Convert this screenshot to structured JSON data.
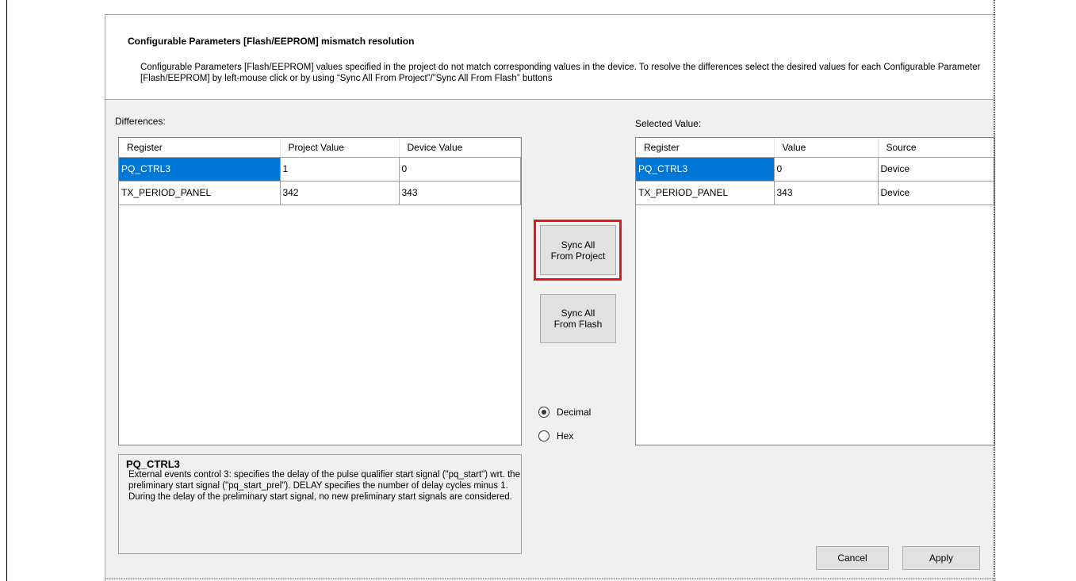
{
  "dialog": {
    "title": "Configurable Parameters [Flash/EEPROM] mismatch resolution",
    "description": "Configurable Parameters [Flash/EEPROM] values specified in the project do not match corresponding values in the device. To resolve the differences select the desired values for each Configurable Parameter [Flash/EEPROM] by left-mouse click or by using “Sync All From Project”/”Sync All From Flash” buttons"
  },
  "differences": {
    "label": "Differences:",
    "columns": [
      "Register",
      "Project Value",
      "Device Value"
    ],
    "rows": [
      [
        "PQ_CTRL3",
        "1",
        "0"
      ],
      [
        "TX_PERIOD_PANEL",
        "342",
        "343"
      ]
    ]
  },
  "selected": {
    "label": "Selected Value:",
    "columns": [
      "Register",
      "Value",
      "Source"
    ],
    "rows": [
      [
        "PQ_CTRL3",
        "0",
        "Device"
      ],
      [
        "TX_PERIOD_PANEL",
        "343",
        "Device"
      ]
    ]
  },
  "buttons": {
    "sync_project_line1": "Sync All",
    "sync_project_line2": "From Project",
    "sync_flash_line1": "Sync All",
    "sync_flash_line2": "From Flash",
    "cancel": "Cancel",
    "apply": "Apply"
  },
  "format": {
    "options": [
      "Decimal",
      "Hex"
    ],
    "selected": "Decimal"
  },
  "info": {
    "title": "PQ_CTRL3",
    "text": "External events control 3: specifies the delay of the pulse qualifier start signal (\"pq_start\") wrt. the preliminary start signal (\"pq_start_prel\"). DELAY specifies the number of delay cycles minus 1. During the delay of the preliminary start signal, no new preliminary start signals are considered."
  },
  "colors": {
    "selection": "#0078d7",
    "highlight": "#e8141c",
    "dialog_bg": "#f0f0f0"
  }
}
